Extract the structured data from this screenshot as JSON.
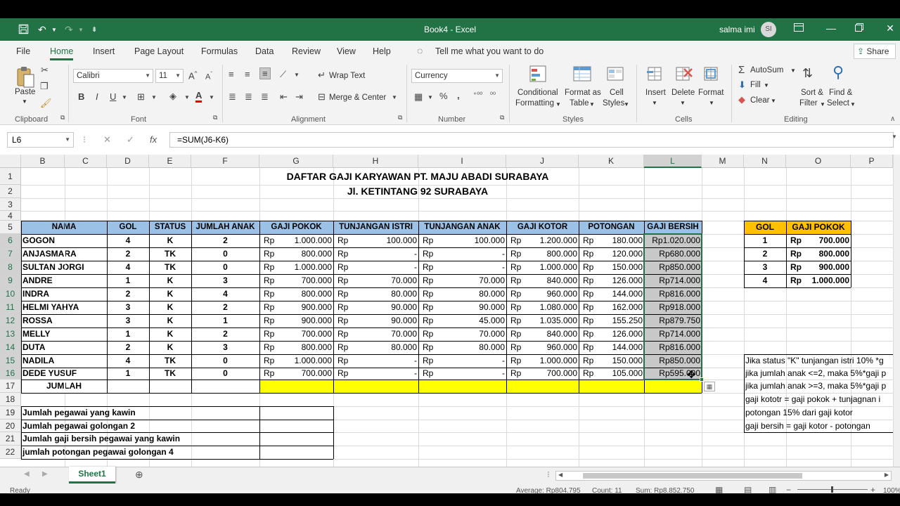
{
  "title": "Book4  -  Excel",
  "user": {
    "name": "salma imi",
    "initials": "SI"
  },
  "colors": {
    "accent": "#217346",
    "header_fill": "#9BC2E6",
    "gold_fill": "#FFC000",
    "yellow_fill": "#FFFF00",
    "selected_fill": "#C8C8C8"
  },
  "menu": {
    "tabs": [
      "File",
      "Home",
      "Insert",
      "Page Layout",
      "Formulas",
      "Data",
      "Review",
      "View",
      "Help"
    ],
    "tell": "Tell me what you want to do",
    "share": "Share"
  },
  "ribbon": {
    "clipboard": {
      "paste": "Paste",
      "label": "Clipboard"
    },
    "font": {
      "name": "Calibri",
      "size": "11",
      "label": "Font",
      "bold": "B",
      "italic": "I",
      "underline": "U"
    },
    "alignment": {
      "wrap": "Wrap Text",
      "merge": "Merge & Center",
      "label": "Alignment"
    },
    "number": {
      "format": "Currency",
      "label": "Number"
    },
    "styles": {
      "cond1": "Conditional",
      "cond2": "Formatting",
      "fmt1": "Format as",
      "fmt2": "Table",
      "cell1": "Cell",
      "cell2": "Styles",
      "label": "Styles"
    },
    "cells": {
      "insert": "Insert",
      "delete": "Delete",
      "format": "Format",
      "label": "Cells"
    },
    "editing": {
      "autosum": "AutoSum",
      "fill": "Fill",
      "clear": "Clear",
      "sort1": "Sort &",
      "sort2": "Filter",
      "find1": "Find &",
      "find2": "Select",
      "label": "Editing"
    }
  },
  "formula": {
    "namebox": "L6",
    "content": "=SUM(J6-K6)"
  },
  "sheet": {
    "columns": [
      "B",
      "C",
      "D",
      "E",
      "F",
      "G",
      "H",
      "I",
      "J",
      "K",
      "L",
      "M",
      "N",
      "O",
      "P"
    ],
    "rows": [
      "1",
      "2",
      "3",
      "4",
      "5",
      "6",
      "7",
      "8",
      "9",
      "10",
      "11",
      "12",
      "13",
      "14",
      "15",
      "16",
      "17",
      "18",
      "19",
      "20",
      "21",
      "22"
    ],
    "title1": "DAFTAR GAJI KARYAWAN PT. MAJU ABADI SURABAYA",
    "title2": "Jl. KETINTANG 92 SURABAYA",
    "headers": [
      "NAMA",
      "GOL",
      "STATUS",
      "JUMLAH ANAK",
      "GAJI POKOK",
      "TUNJANGAN ISTRI",
      "TUNJANGAN ANAK",
      "GAJI KOTOR",
      "POTONGAN",
      "GAJI BERSIH"
    ],
    "currency": "Rp",
    "employees": [
      {
        "nama": "GOGON",
        "gol": "4",
        "status": "K",
        "anak": "2",
        "pokok": "1.000.000",
        "istri": "100.000",
        "tanak": "100.000",
        "kotor": "1.200.000",
        "potongan": "180.000",
        "bersih": "Rp1.020.000"
      },
      {
        "nama": "ANJASMARA",
        "gol": "2",
        "status": "TK",
        "anak": "0",
        "pokok": "800.000",
        "istri": "-",
        "tanak": "-",
        "kotor": "800.000",
        "potongan": "120.000",
        "bersih": "Rp680.000"
      },
      {
        "nama": "SULTAN JORGI",
        "gol": "4",
        "status": "TK",
        "anak": "0",
        "pokok": "1.000.000",
        "istri": "-",
        "tanak": "-",
        "kotor": "1.000.000",
        "potongan": "150.000",
        "bersih": "Rp850.000"
      },
      {
        "nama": "ANDRE",
        "gol": "1",
        "status": "K",
        "anak": "3",
        "pokok": "700.000",
        "istri": "70.000",
        "tanak": "70.000",
        "kotor": "840.000",
        "potongan": "126.000",
        "bersih": "Rp714.000"
      },
      {
        "nama": "INDRA",
        "gol": "2",
        "status": "K",
        "anak": "4",
        "pokok": "800.000",
        "istri": "80.000",
        "tanak": "80.000",
        "kotor": "960.000",
        "potongan": "144.000",
        "bersih": "Rp816.000"
      },
      {
        "nama": "HELMI YAHYA",
        "gol": "3",
        "status": "K",
        "anak": "2",
        "pokok": "900.000",
        "istri": "90.000",
        "tanak": "90.000",
        "kotor": "1.080.000",
        "potongan": "162.000",
        "bersih": "Rp918.000"
      },
      {
        "nama": "ROSSA",
        "gol": "3",
        "status": "K",
        "anak": "1",
        "pokok": "900.000",
        "istri": "90.000",
        "tanak": "45.000",
        "kotor": "1.035.000",
        "potongan": "155.250",
        "bersih": "Rp879.750"
      },
      {
        "nama": "MELLY",
        "gol": "1",
        "status": "K",
        "anak": "2",
        "pokok": "700.000",
        "istri": "70.000",
        "tanak": "70.000",
        "kotor": "840.000",
        "potongan": "126.000",
        "bersih": "Rp714.000"
      },
      {
        "nama": "DUTA",
        "gol": "2",
        "status": "K",
        "anak": "3",
        "pokok": "800.000",
        "istri": "80.000",
        "tanak": "80.000",
        "kotor": "960.000",
        "potongan": "144.000",
        "bersih": "Rp816.000"
      },
      {
        "nama": "NADILA",
        "gol": "4",
        "status": "TK",
        "anak": "0",
        "pokok": "1.000.000",
        "istri": "-",
        "tanak": "-",
        "kotor": "1.000.000",
        "potongan": "150.000",
        "bersih": "Rp850.000"
      },
      {
        "nama": "DEDE YUSUF",
        "gol": "1",
        "status": "TK",
        "anak": "0",
        "pokok": "700.000",
        "istri": "-",
        "tanak": "-",
        "kotor": "700.000",
        "potongan": "105.000",
        "bersih": "Rp595.000"
      }
    ],
    "jumlah": "JUMLAH",
    "summary": [
      "Jumlah pegawai yang kawin",
      "Jumlah pegawai golongan 2",
      "Jumlah gaji bersih pegawai yang kawin",
      "jumlah potongan pegawai golongan 4"
    ],
    "gol_table": {
      "headers": [
        "GOL",
        "GAJI POKOK"
      ],
      "rows": [
        {
          "gol": "1",
          "gaji": "700.000"
        },
        {
          "gol": "2",
          "gaji": "800.000"
        },
        {
          "gol": "3",
          "gaji": "900.000"
        },
        {
          "gol": "4",
          "gaji": "1.000.000"
        }
      ]
    },
    "notes": [
      "Jika status \"K\" tunjangan istri 10% *g",
      "jika jumlah anak <=2, maka 5%*gaji p",
      "jika jumlah anak >=3, maka 5%*gaji p",
      "gaji kototr = gaji pokok + tunjagnan i",
      "potongan 15% dari gaji kotor",
      "gaji bersih = gaji kotor - potongan"
    ]
  },
  "tabs": {
    "sheet": "Sheet1"
  },
  "status": {
    "ready": "Ready",
    "average": "Average: Rp804.795",
    "count": "Count: 11",
    "sum": "Sum: Rp8.852.750",
    "zoom": "100%"
  }
}
